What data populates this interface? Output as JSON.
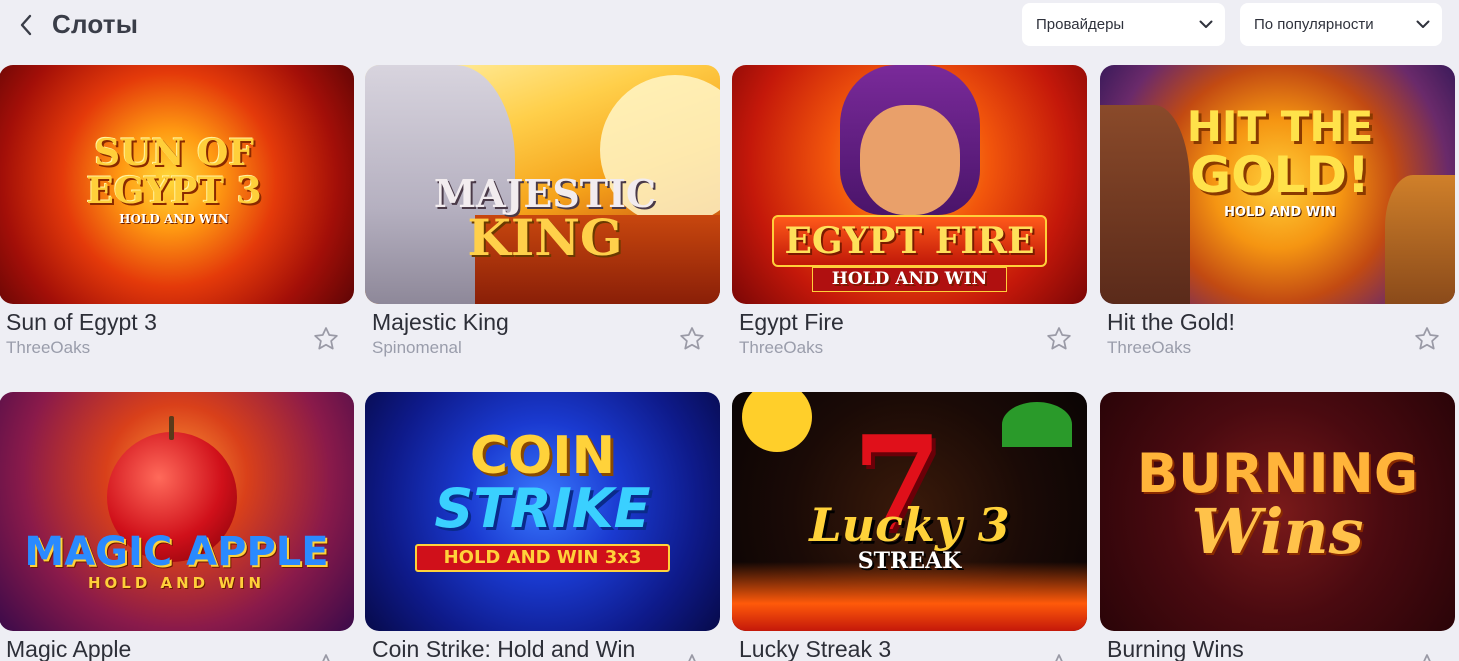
{
  "header": {
    "title": "Слоты",
    "providers_dropdown": "Провайдеры",
    "sort_dropdown": "По популярности"
  },
  "games": [
    {
      "name": "Sun of Egypt 3",
      "provider": "ThreeOaks",
      "logo_line1": "SUN OF",
      "logo_line2": "EGYPT 3",
      "logo_tag": "HOLD AND WIN"
    },
    {
      "name": "Majestic King",
      "provider": "Spinomenal",
      "logo_line1": "MAJESTIC",
      "logo_line2": "KING",
      "logo_tag": ""
    },
    {
      "name": "Egypt Fire",
      "provider": "ThreeOaks",
      "logo_line1": "EGYPT FIRE",
      "logo_line2": "",
      "logo_tag": "HOLD AND WIN"
    },
    {
      "name": "Hit the Gold!",
      "provider": "ThreeOaks",
      "logo_line1": "HIT THE",
      "logo_line2": "GOLD!",
      "logo_tag": "HOLD AND WIN"
    },
    {
      "name": "Magic Apple",
      "provider": "",
      "logo_line1": "MAGIC APPLE",
      "logo_line2": "",
      "logo_tag": "HOLD AND WIN"
    },
    {
      "name": "Coin Strike: Hold and Win",
      "provider": "",
      "logo_line1": "COIN",
      "logo_line2": "STRIKE",
      "logo_tag": "HOLD AND WIN 3x3"
    },
    {
      "name": "Lucky Streak 3",
      "provider": "",
      "logo_line1": "Lucky 3",
      "logo_line2": "STREAK",
      "logo_tag": ""
    },
    {
      "name": "Burning Wins",
      "provider": "",
      "logo_line1": "BURNING",
      "logo_line2": "Wins",
      "logo_tag": ""
    }
  ],
  "icons": {
    "back": "chevron-left-icon",
    "dropdown": "chevron-down-icon",
    "favorite": "star-outline-icon"
  },
  "colors": {
    "background": "#eeeef4",
    "title": "#3a3d48",
    "provider_text": "#9a9dab",
    "star": "#9a9aa6"
  }
}
